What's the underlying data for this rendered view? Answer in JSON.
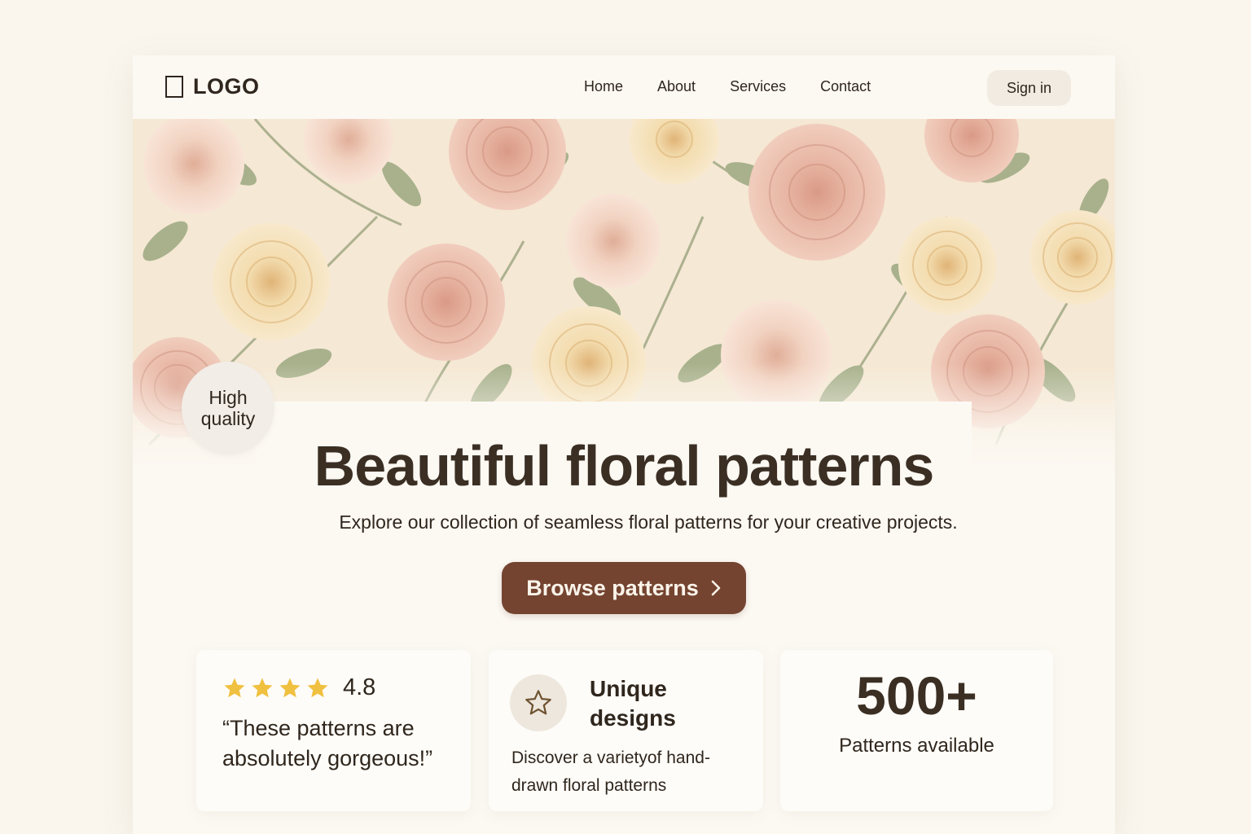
{
  "nav": {
    "logo": "LOGO",
    "links": [
      "Home",
      "About",
      "Services",
      "Contact"
    ],
    "signin": "Sign in"
  },
  "hero": {
    "badge_line1": "High",
    "badge_line2": "quality",
    "title": "Beautiful floral patterns",
    "subtitle": "Explore our collection of seamless floral patterns for your creative projects.",
    "cta": "Browse patterns",
    "colors": {
      "cta": "#744431",
      "background": "#faf6ee",
      "pattern_pink": "#e8b5a3",
      "pattern_cream": "#f4ddb0",
      "leaf": "#a9b08c"
    }
  },
  "features": {
    "review": {
      "star_count": 4,
      "rating": "4.8",
      "quote_line1": "“These patterns are",
      "quote_line2": "absolutely gorgeous!”"
    },
    "unique": {
      "icon": "star-outline-icon",
      "title_line1": "Unique",
      "title_line2": "designs",
      "desc_line1": "Discover a varietyof hand-",
      "desc_line2": "drawn floral patterns"
    },
    "count": {
      "number": "500+",
      "label": "Patterns available"
    }
  }
}
